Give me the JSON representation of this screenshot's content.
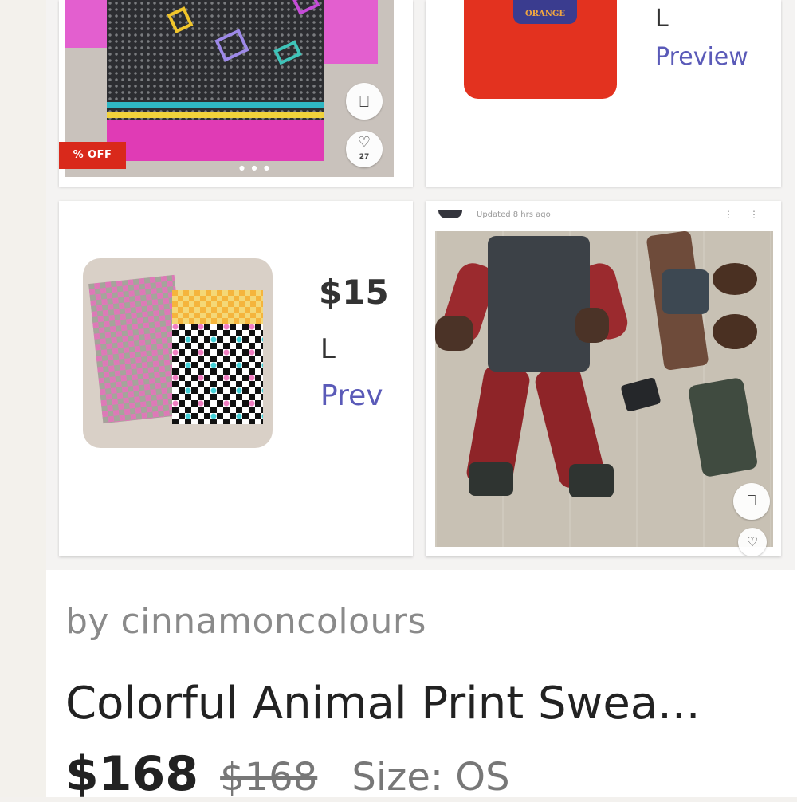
{
  "tiles": [
    {
      "badge": "% OFF",
      "likes": "27",
      "icons": [
        "bookmark-icon",
        "heart-icon"
      ]
    },
    {
      "print_text": "ORANGE",
      "size": "L",
      "preview": "Preview"
    },
    {
      "price": "$15",
      "size": "L",
      "preview": "Prev"
    },
    {
      "updated": "Updated 8 hrs ago",
      "icons": [
        "bookmark-icon",
        "heart-icon"
      ]
    }
  ],
  "listing": {
    "seller": "by cinnamoncolours",
    "title": "Colorful Animal Print Swea...",
    "price": "$168",
    "original_price": "$168",
    "size": "Size: OS"
  },
  "colors": {
    "sale_badge": "#d9291b",
    "preview_link": "#5a5ab8"
  }
}
